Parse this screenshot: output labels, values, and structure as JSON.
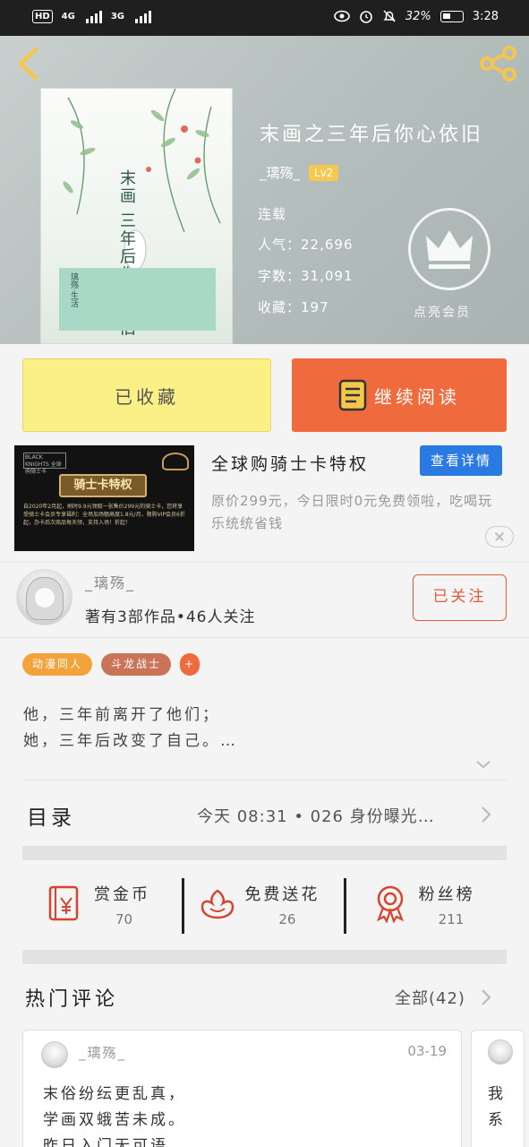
{
  "status_bar": {
    "hd": "HD",
    "net1": "4G",
    "net2": "3G",
    "battery": "32%",
    "time": "3:28"
  },
  "book": {
    "title": "末画之三年后你心依旧",
    "author": "_璃殇_",
    "level": "Lv2",
    "status": "连载",
    "popularity": "人气：22,696",
    "word_count": "字数：31,091",
    "favorites": "收藏：197",
    "vip_label": "点亮会员",
    "cover": {
      "title": "末画 三年后你心依旧",
      "author_tag": "璃殇·生活"
    }
  },
  "actions": {
    "favorited": "已收藏",
    "continue_reading": "继续阅读"
  },
  "ad": {
    "image_title": "骑士卡特权",
    "image_logo": "BLACK KNIGHTS 全球购骑士卡",
    "image_fine_print": "自2020年2月起，刷时9.9元领取一张售价299元的骑士卡，您将享受骑士卡会员专享福利：全场加场额高度1.8元/月，限购VIP会员6折起，办卡后次商品每天领，支持入场！折起！",
    "title": "全球购骑士卡特权",
    "detail_button": "查看详情",
    "description": "原价299元，今日限时0元免费领啦，吃喝玩乐统统省钱"
  },
  "author_panel": {
    "name": "_璃殇_",
    "info": "著有3部作品•46人关注",
    "follow_button": "已关注"
  },
  "tags": [
    "动漫同人",
    "斗龙战士",
    "+"
  ],
  "synopsis": {
    "line1": "他，三年前离开了他们；",
    "line2": "她，三年后改变了自己。…"
  },
  "toc": {
    "label": "目录",
    "latest": "今天 08:31 • 026 身份曝光…"
  },
  "stats": [
    {
      "label": "赏金币",
      "value": "70",
      "icon": "red-envelope-icon"
    },
    {
      "label": "免费送花",
      "value": "26",
      "icon": "flower-icon"
    },
    {
      "label": "粉丝榜",
      "value": "211",
      "icon": "medal-icon"
    }
  ],
  "comments": {
    "label": "热门评论",
    "all": "全部(42)",
    "items": [
      {
        "user": "_璃殇_",
        "date": "03-19",
        "line1": "末俗纷纭更乱真，",
        "line2": "学画双蛾苦未成。",
        "line3": "昨日入门无可语"
      },
      {
        "line1": "我",
        "line2": "系"
      }
    ]
  },
  "colors": {
    "accent_orange": "#ef6a3c",
    "favorite_yellow": "#fbf085",
    "level_badge": "#f6c94c",
    "detail_blue": "#2a7ae4",
    "icon_red": "#d8442f"
  }
}
